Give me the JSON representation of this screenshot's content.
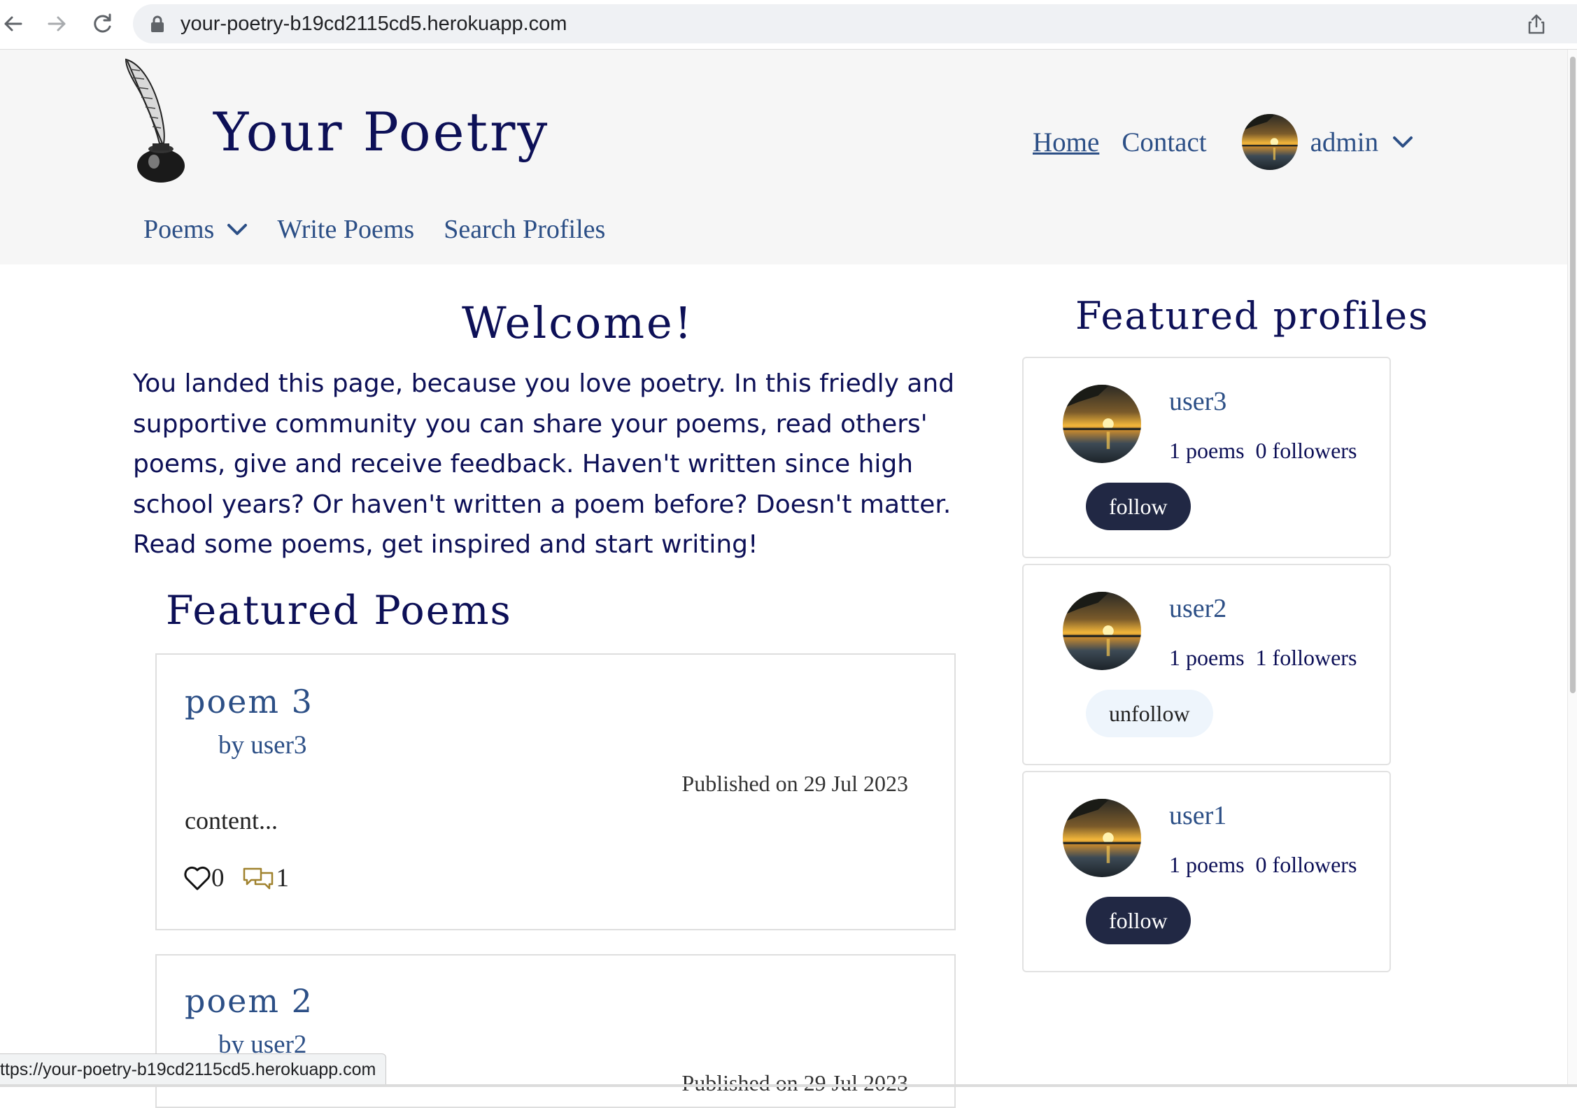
{
  "browser": {
    "url": "your-poetry-b19cd2115cd5.herokuapp.com",
    "status_url": "ttps://your-poetry-b19cd2115cd5.herokuapp.com"
  },
  "header": {
    "brand": "Your Poetry",
    "links": {
      "home": "Home",
      "contact": "Contact"
    },
    "user": "admin",
    "sub_nav": {
      "poems": "Poems",
      "write": "Write Poems",
      "search": "Search Profiles"
    }
  },
  "main": {
    "welcome_title": "Welcome!",
    "intro": "You landed this page, because you love poetry. In this friedly and supportive community you can share your poems, read others' poems, give and receive feedback. Haven't written since high school years? Or haven't written a poem before? Doesn't matter. Read some poems, get inspired and start writing!",
    "featured_title": "Featured Poems",
    "poems": [
      {
        "title": "poem 3",
        "author": "by user3",
        "date": "Published on 29 Jul 2023",
        "excerpt": "content...",
        "likes": "0",
        "comments": "1"
      },
      {
        "title": "poem 2",
        "author": "by user2",
        "date": "Published on 29 Jul 2023"
      }
    ]
  },
  "sidebar": {
    "title": "Featured profiles",
    "profiles": [
      {
        "name": "user3",
        "stats": "1 poems  0 followers",
        "button": "follow"
      },
      {
        "name": "user2",
        "stats": "1 poems  1 followers",
        "button": "unfollow"
      },
      {
        "name": "user1",
        "stats": "1 poems  0 followers",
        "button": "follow"
      }
    ]
  },
  "colors": {
    "navy": "#0d1057",
    "link": "#2c4f86",
    "button_dark": "#212844",
    "button_light": "#eef5fc",
    "header_bg": "#f6f6f6"
  }
}
